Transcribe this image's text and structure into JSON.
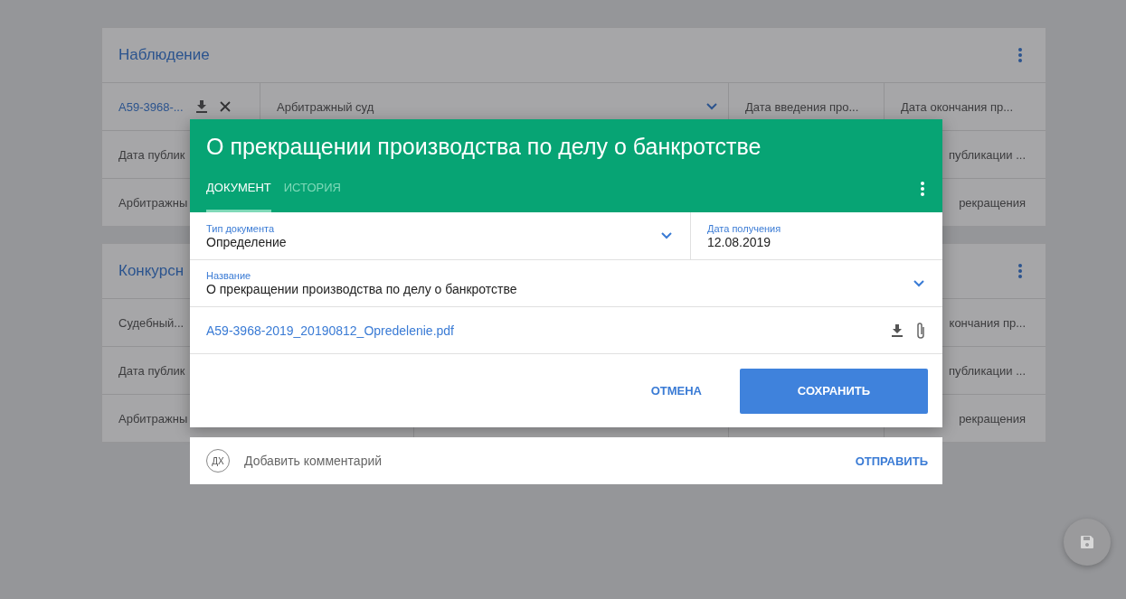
{
  "cards": [
    {
      "title": "Наблюдение",
      "rows": [
        {
          "kind": "first",
          "cells": [
            {
              "kind": "file",
              "text": "A59-3968-..."
            },
            {
              "kind": "select",
              "text": "Арбитражный суд"
            },
            {
              "kind": "text",
              "text": "Дата введения про..."
            },
            {
              "kind": "text",
              "text": "Дата окончания пр..."
            }
          ]
        },
        {
          "kind": "split",
          "cells": [
            {
              "kind": "text",
              "text": "Дата публик"
            },
            {
              "kind": "empty"
            },
            {
              "kind": "empty"
            },
            {
              "kind": "text",
              "text": "публикации ...",
              "covered_start": true
            }
          ]
        },
        {
          "kind": "split",
          "cells": [
            {
              "kind": "text",
              "text": "Арбитражны"
            },
            {
              "kind": "empty"
            },
            {
              "kind": "empty"
            },
            {
              "kind": "text",
              "text": "рекращения",
              "covered_start": true
            }
          ]
        }
      ]
    },
    {
      "title": "Конкурсн",
      "rows": [
        {
          "kind": "first",
          "cells": [
            {
              "kind": "text",
              "text": "Судебный..."
            },
            {
              "kind": "empty"
            },
            {
              "kind": "empty"
            },
            {
              "kind": "text",
              "text": "кончания пр...",
              "covered_start": true
            }
          ]
        },
        {
          "kind": "split",
          "cells": [
            {
              "kind": "text",
              "text": "Дата публик"
            },
            {
              "kind": "empty"
            },
            {
              "kind": "empty"
            },
            {
              "kind": "text",
              "text": "публикации ...",
              "covered_start": true
            }
          ]
        },
        {
          "kind": "split",
          "cells": [
            {
              "kind": "text",
              "text": "Арбитражны"
            },
            {
              "kind": "empty"
            },
            {
              "kind": "empty"
            },
            {
              "kind": "text",
              "text": "рекращения",
              "covered_start": true
            }
          ]
        }
      ]
    }
  ],
  "dialog": {
    "title": "О прекращении производства по делу о банкротстве",
    "tabs": [
      {
        "label": "ДОКУМЕНТ",
        "selected": true
      },
      {
        "label": "ИСТОРИЯ",
        "selected": false
      }
    ],
    "fields": [
      {
        "label": "Тип документа",
        "value": "Определение",
        "kind": "select"
      },
      {
        "label": "Дата получения",
        "value": "12.08.2019",
        "kind": "text"
      }
    ],
    "name_field": {
      "label": "Название",
      "value": "О прекращении производства по делу о банкротстве"
    },
    "file": {
      "name": "A59-3968-2019_20190812_Opredelenie.pdf"
    },
    "buttons": [
      {
        "label": "ОТМЕНА",
        "kind": "flat"
      },
      {
        "label": "СОХРАНИТЬ",
        "kind": "raised"
      }
    ]
  },
  "comment": {
    "avatar": "ДХ",
    "placeholder": "Добавить комментарий",
    "send": "ОТПРАВИТЬ"
  }
}
